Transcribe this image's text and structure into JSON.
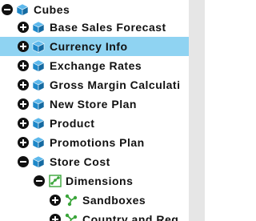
{
  "tree": {
    "root": {
      "label": "Cubes",
      "expanded": true
    },
    "cubes": [
      {
        "label": "Base Sales Forecast",
        "expanded": false,
        "selected": false
      },
      {
        "label": "Currency Info",
        "expanded": false,
        "selected": true
      },
      {
        "label": "Exchange Rates",
        "expanded": false,
        "selected": false
      },
      {
        "label": "Gross Margin Calculati",
        "expanded": false,
        "selected": false
      },
      {
        "label": "New Store Plan",
        "expanded": false,
        "selected": false
      },
      {
        "label": "Product",
        "expanded": false,
        "selected": false
      },
      {
        "label": "Promotions Plan",
        "expanded": false,
        "selected": false
      },
      {
        "label": "Store Cost",
        "expanded": true,
        "selected": false
      }
    ],
    "store_cost_children": {
      "dimensions": {
        "label": "Dimensions",
        "expanded": true
      },
      "items": [
        {
          "label": "Sandboxes",
          "expanded": false
        },
        {
          "label": "Country and Reg",
          "expanded": false
        }
      ]
    }
  },
  "colors": {
    "selected_row": "#8fd3f2",
    "cube_icon": "#1e88c9",
    "dimension_icon": "#3aa53a",
    "toggle": "#111111"
  },
  "icons": {
    "expanded": "minus-circle-icon",
    "collapsed": "plus-circle-icon",
    "cube": "cube-icon",
    "dimension": "dimension-icon"
  }
}
